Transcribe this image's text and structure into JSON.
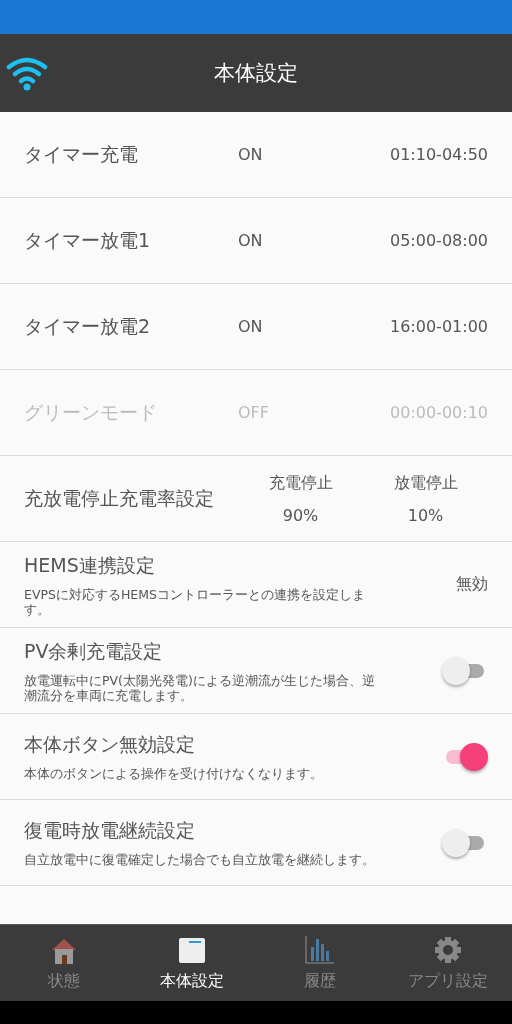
{
  "header": {
    "title": "本体設定"
  },
  "settings": [
    {
      "kind": "timer",
      "name": "タイマー充電",
      "status": "ON",
      "time": "01:10-04:50",
      "disabled": false
    },
    {
      "kind": "timer",
      "name": "タイマー放電1",
      "status": "ON",
      "time": "05:00-08:00",
      "disabled": false
    },
    {
      "kind": "timer",
      "name": "タイマー放電2",
      "status": "ON",
      "time": "16:00-01:00",
      "disabled": false
    },
    {
      "kind": "timer",
      "name": "グリーンモード",
      "status": "OFF",
      "time": "00:00-00:10",
      "disabled": true
    },
    {
      "kind": "rate",
      "name": "充放電停止充電率設定",
      "columns": [
        {
          "label": "充電停止",
          "value": "90%"
        },
        {
          "label": "放電停止",
          "value": "10%"
        }
      ]
    },
    {
      "kind": "value",
      "name": "HEMS連携設定",
      "description": "EVPSに対応するHEMSコントローラーとの連携を設定します。",
      "value": "無効"
    },
    {
      "kind": "toggle",
      "name": "PV余剰充電設定",
      "description": "放電運転中にPV(太陽光発電)による逆潮流が生じた場合、逆潮流分を車両に充電します。",
      "on": false
    },
    {
      "kind": "toggle",
      "name": "本体ボタン無効設定",
      "description": "本体のボタンによる操作を受け付けなくなります。",
      "on": true
    },
    {
      "kind": "toggle",
      "name": "復電時放電継続設定",
      "description": "自立放電中に復電確定した場合でも自立放電を継続します。",
      "on": false
    }
  ],
  "nav": [
    {
      "kind": "home",
      "label": "状態",
      "selected": false
    },
    {
      "kind": "device",
      "label": "本体設定",
      "selected": true
    },
    {
      "kind": "history",
      "label": "履歴",
      "selected": false
    },
    {
      "kind": "settings",
      "label": "アプリ設定",
      "selected": false
    }
  ]
}
